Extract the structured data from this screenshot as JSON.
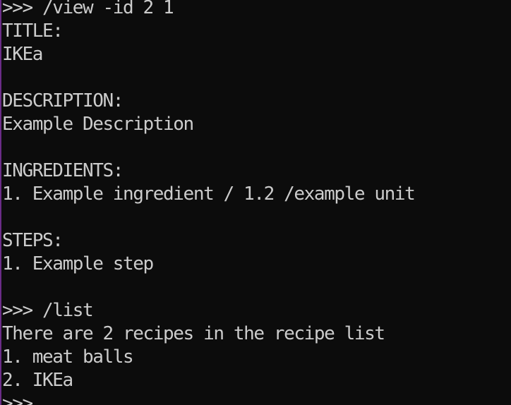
{
  "terminal": {
    "lines": [
      ">>> /view -id 2 1",
      "TITLE:",
      "IKEa",
      "",
      "DESCRIPTION:",
      "Example Description",
      "",
      "INGREDIENTS:",
      "1. Example ingredient / 1.2 /example unit",
      "",
      "STEPS:",
      "1. Example step",
      "",
      ">>> /list",
      "There are 2 recipes in the recipe list",
      "1. meat balls",
      "2. IKEa",
      ">>>"
    ]
  },
  "colors": {
    "background": "#0c0c0c",
    "text": "#cccccc",
    "left_edge_accent": "#6b2c87"
  }
}
